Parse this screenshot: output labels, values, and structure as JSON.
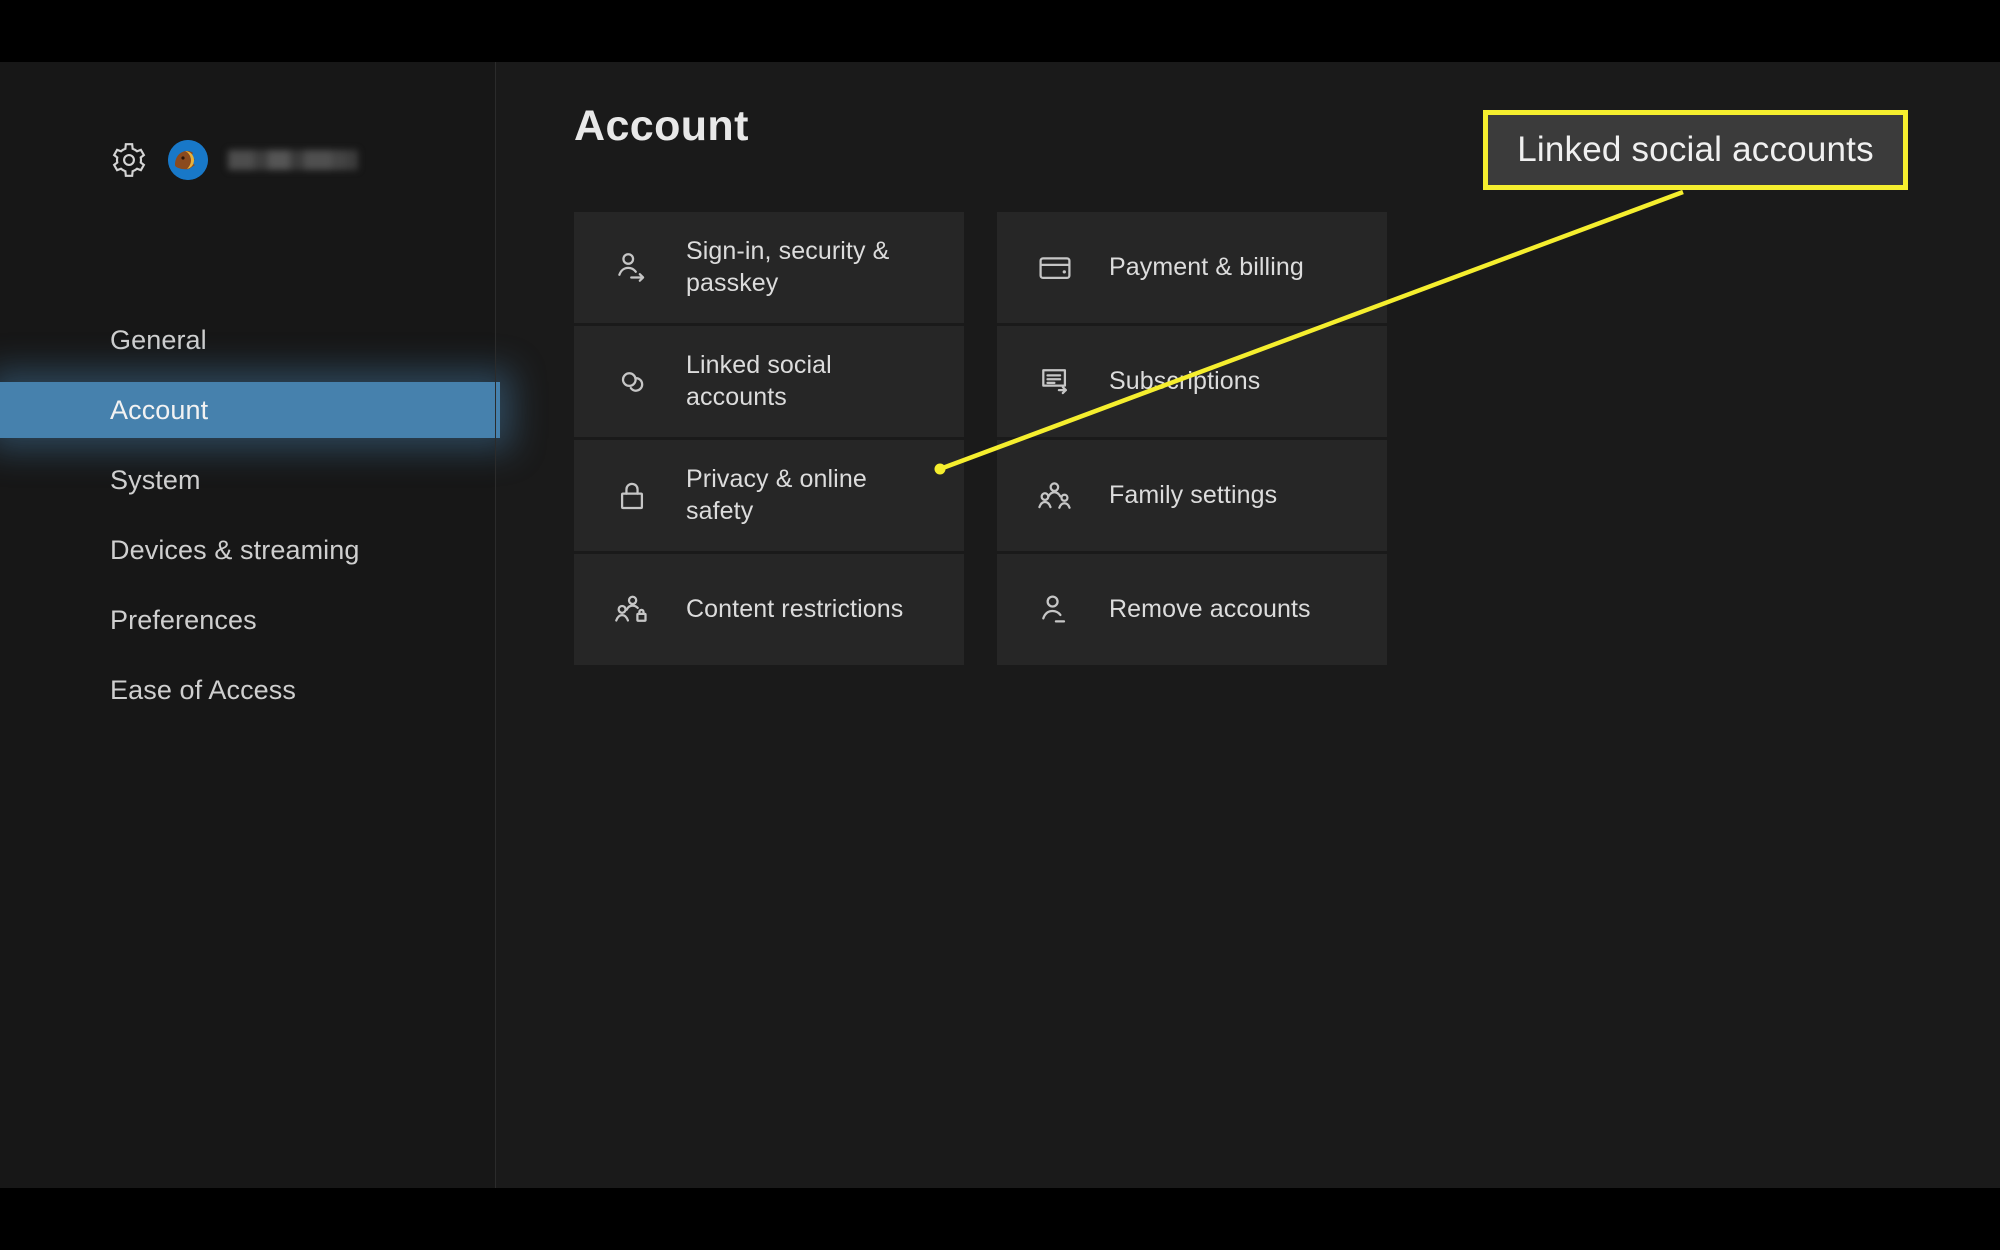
{
  "sidebar": {
    "gear_icon": "gear-icon",
    "avatar_icon": "avatar",
    "gamertag_redacted": "",
    "items": [
      {
        "label": "General",
        "active": false
      },
      {
        "label": "Account",
        "active": true
      },
      {
        "label": "System",
        "active": false
      },
      {
        "label": "Devices & streaming",
        "active": false
      },
      {
        "label": "Preferences",
        "active": false
      },
      {
        "label": "Ease of Access",
        "active": false
      }
    ]
  },
  "content": {
    "title": "Account",
    "tiles": [
      {
        "label": "Sign-in, security & passkey",
        "icon": "person-arrow-icon"
      },
      {
        "label": "Payment & billing",
        "icon": "credit-card-icon"
      },
      {
        "label": "Linked social accounts",
        "icon": "chain-link-icon"
      },
      {
        "label": "Subscriptions",
        "icon": "document-arrow-icon"
      },
      {
        "label": "Privacy & online safety",
        "icon": "lock-icon"
      },
      {
        "label": "Family settings",
        "icon": "people-family-icon"
      },
      {
        "label": "Content restrictions",
        "icon": "people-lock-icon"
      },
      {
        "label": "Remove accounts",
        "icon": "person-minus-icon"
      }
    ]
  },
  "annotation": {
    "callout_label": "Linked social accounts",
    "border_color": "#f5ee2e",
    "box_fill": "#3b3b3b",
    "line_color": "#f5ee2e",
    "pointer_target": "linked-social-accounts-tile"
  },
  "colors": {
    "background": "#1a1a1a",
    "tile": "#262626",
    "accent_highlight": "#4681ad",
    "letterbox": "#000000"
  }
}
